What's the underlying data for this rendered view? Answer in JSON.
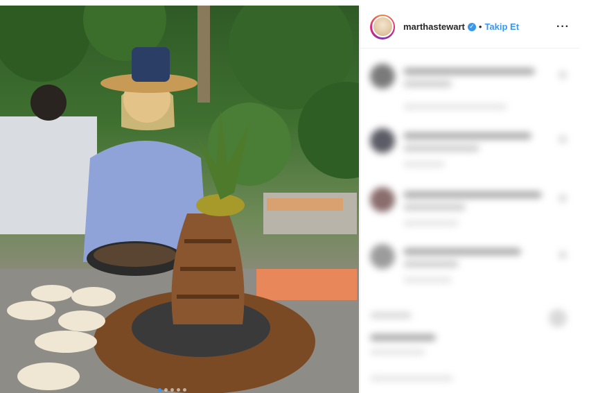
{
  "post": {
    "username": "marthastewart",
    "separator": "•",
    "follow_label": "Takip Et",
    "more_icon": "···",
    "verified_icon": "✓",
    "carousel": {
      "dot_count": 5,
      "active_index": 0
    },
    "colors": {
      "accent": "#3897f0",
      "text": "#262626"
    }
  }
}
